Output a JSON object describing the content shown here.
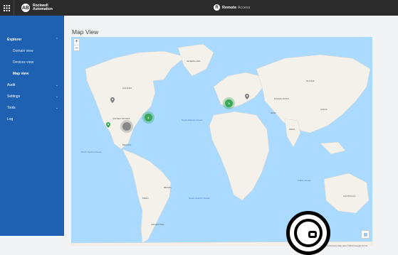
{
  "header": {
    "brand_line1": "Rockwell",
    "brand_line2": "Automation",
    "app_name": "Remote",
    "app_suffix": "Access"
  },
  "sidebar": {
    "items": [
      {
        "label": "Explorer",
        "expanded": true
      },
      {
        "label": "Domain view"
      },
      {
        "label": "Devices view"
      },
      {
        "label": "Map view",
        "active": true
      },
      {
        "label": "Audit"
      },
      {
        "label": "Settings"
      },
      {
        "label": "Tools"
      },
      {
        "label": "Log"
      }
    ]
  },
  "main": {
    "title": "Map View",
    "zoom_in": "+",
    "zoom_out": "–",
    "copyright": "Keyboard shortcuts  Map data ©2023 Google  Terms"
  },
  "map_labels": {
    "canada": "CANADA",
    "united_states": "UNITED STATES",
    "mexico": "MEXICO",
    "brazil": "BRAZIL",
    "russia": "RUSSIA",
    "china": "CHINA",
    "india": "INDIA",
    "australia": "AUSTRALIA",
    "greenland": "GREENLAND",
    "kazakhstan": "KAZAKHSTAN",
    "iran": "IRAN",
    "peru": "PERU",
    "argentina": "ARGENTINA",
    "north_atlantic": "North Atlantic Ocean",
    "south_atlantic": "South Atlantic Ocean",
    "north_pacific": "North Pacific Ocean",
    "indian_ocean": "Indian Ocean"
  },
  "clusters": [
    {
      "count": "3",
      "color": "#3aa858"
    },
    {
      "count": "2",
      "color": "#3aa858"
    },
    {
      "count": "",
      "color": "#888888"
    }
  ],
  "pins": [
    {
      "color": "#7f7f7f"
    },
    {
      "color": "#3aa858"
    },
    {
      "color": "#7f7f7f"
    }
  ]
}
